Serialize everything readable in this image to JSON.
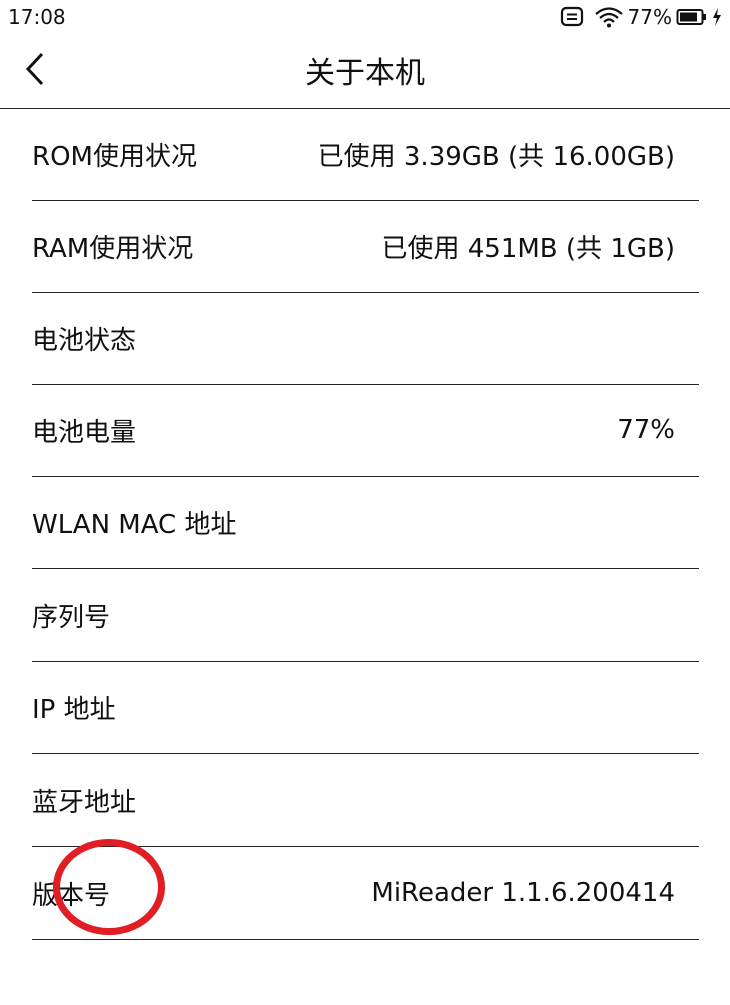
{
  "status_bar": {
    "time": "17:08",
    "battery_percent": "77%",
    "icons": [
      "notification-icon",
      "wifi-icon",
      "battery-icon",
      "charging-icon"
    ]
  },
  "header": {
    "back_icon": "chevron-left-icon",
    "title": "关于本机"
  },
  "rows": [
    {
      "label": "ROM使用状况",
      "value": "已使用 3.39GB (共 16.00GB)"
    },
    {
      "label": "RAM使用状况",
      "value": "已使用 451MB (共 1GB)"
    },
    {
      "label": "电池状态",
      "value": ""
    },
    {
      "label": "电池电量",
      "value": "77%"
    },
    {
      "label": "WLAN MAC 地址",
      "value": ""
    },
    {
      "label": "序列号",
      "value": ""
    },
    {
      "label": "IP 地址",
      "value": ""
    },
    {
      "label": "蓝牙地址",
      "value": ""
    },
    {
      "label": "版本号",
      "value": "MiReader  1.1.6.200414"
    }
  ],
  "colors": {
    "annotation": "#e01e25",
    "divider": "#222222",
    "text": "#111111"
  }
}
